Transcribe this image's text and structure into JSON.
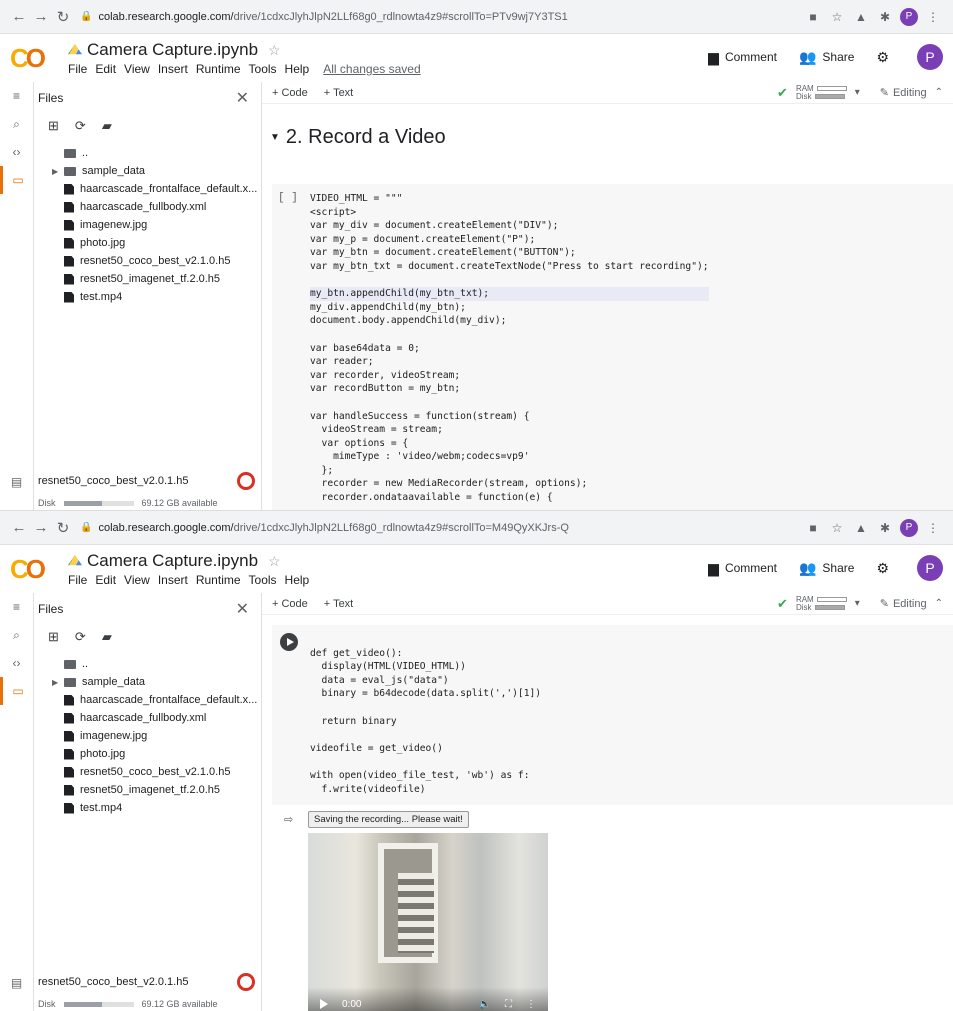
{
  "pane1": {
    "url_prefix": "colab.research.google.com/",
    "url_rest": "drive/1cdxcJlyhJlpN2LLf68g0_rdlnowta4z9#scrollTo=PTv9wj7Y3TS1",
    "avatar": "P",
    "notebook_title": "Camera Capture.ipynb",
    "menu": [
      "File",
      "Edit",
      "View",
      "Insert",
      "Runtime",
      "Tools",
      "Help"
    ],
    "saved": "All changes saved",
    "comment": "Comment",
    "share": "Share",
    "files_title": "Files",
    "add_code": "+ Code",
    "add_text": "+ Text",
    "ram": "RAM",
    "disk_label": "Disk",
    "editing": "Editing",
    "tree": [
      {
        "name": "..",
        "kind": "folder"
      },
      {
        "name": "sample_data",
        "kind": "folder-collapsed"
      },
      {
        "name": "haarcascade_frontalface_default.x...",
        "kind": "file"
      },
      {
        "name": "haarcascade_fullbody.xml",
        "kind": "file"
      },
      {
        "name": "imagenew.jpg",
        "kind": "file"
      },
      {
        "name": "photo.jpg",
        "kind": "file"
      },
      {
        "name": "resnet50_coco_best_v2.1.0.h5",
        "kind": "file"
      },
      {
        "name": "resnet50_imagenet_tf.2.0.h5",
        "kind": "file"
      },
      {
        "name": "test.mp4",
        "kind": "file"
      }
    ],
    "uploading": "resnet50_coco_best_v2.0.1.h5",
    "disk_text": "Disk",
    "disk_avail": "69.12 GB available",
    "disk_fill": 0.55,
    "section_title": "2. Record a Video",
    "cell_gutter": "[ ]",
    "code": [
      "VIDEO_HTML = \"\"\"",
      "<script>",
      "var my_div = document.createElement(\"DIV\");",
      "var my_p = document.createElement(\"P\");",
      "var my_btn = document.createElement(\"BUTTON\");",
      "var my_btn_txt = document.createTextNode(\"Press to start recording\");",
      "",
      "my_btn.appendChild(my_btn_txt);",
      "my_div.appendChild(my_btn);",
      "document.body.appendChild(my_div);",
      "",
      "var base64data = 0;",
      "var reader;",
      "var recorder, videoStream;",
      "var recordButton = my_btn;",
      "",
      "var handleSuccess = function(stream) {",
      "  videoStream = stream;",
      "  var options = {",
      "    mimeType : 'video/webm;codecs=vp9'",
      "  };",
      "  recorder = new MediaRecorder(stream, options);",
      "  recorder.ondataavailable = function(e) {"
    ]
  },
  "pane2": {
    "url_prefix": "colab.research.google.com/",
    "url_rest": "drive/1cdxcJlyhJlpN2LLf68g0_rdlnowta4z9#scrollTo=M49QyXKJrs-Q",
    "avatar": "P",
    "notebook_title": "Camera Capture.ipynb",
    "menu": [
      "File",
      "Edit",
      "View",
      "Insert",
      "Runtime",
      "Tools",
      "Help"
    ],
    "comment": "Comment",
    "share": "Share",
    "files_title": "Files",
    "add_code": "+ Code",
    "add_text": "+ Text",
    "ram": "RAM",
    "disk_label": "Disk",
    "editing": "Editing",
    "tree": [
      {
        "name": "..",
        "kind": "folder"
      },
      {
        "name": "sample_data",
        "kind": "folder-collapsed"
      },
      {
        "name": "haarcascade_frontalface_default.x...",
        "kind": "file"
      },
      {
        "name": "haarcascade_fullbody.xml",
        "kind": "file"
      },
      {
        "name": "imagenew.jpg",
        "kind": "file"
      },
      {
        "name": "photo.jpg",
        "kind": "file"
      },
      {
        "name": "resnet50_coco_best_v2.1.0.h5",
        "kind": "file"
      },
      {
        "name": "resnet50_imagenet_tf.2.0.h5",
        "kind": "file"
      },
      {
        "name": "test.mp4",
        "kind": "file"
      }
    ],
    "uploading": "resnet50_coco_best_v2.0.1.h5",
    "disk_text": "Disk",
    "disk_avail": "69.12 GB available",
    "disk_fill": 0.55,
    "code": [
      "",
      "def get_video():",
      "  display(HTML(VIDEO_HTML))",
      "  data = eval_js(\"data\")",
      "  binary = b64decode(data.split(',')[1])",
      "",
      "  return binary",
      "",
      "videofile = get_video()",
      "",
      "with open(video_file_test, 'wb') as f:",
      "  f.write(videofile)"
    ],
    "output_message": "Saving the recording... Please wait!",
    "video_time": "0:00"
  },
  "colors": {
    "accent": "#e8710a",
    "logo": "#f9ab00",
    "avatar": "#7b3fb5",
    "record": "#d93025"
  }
}
